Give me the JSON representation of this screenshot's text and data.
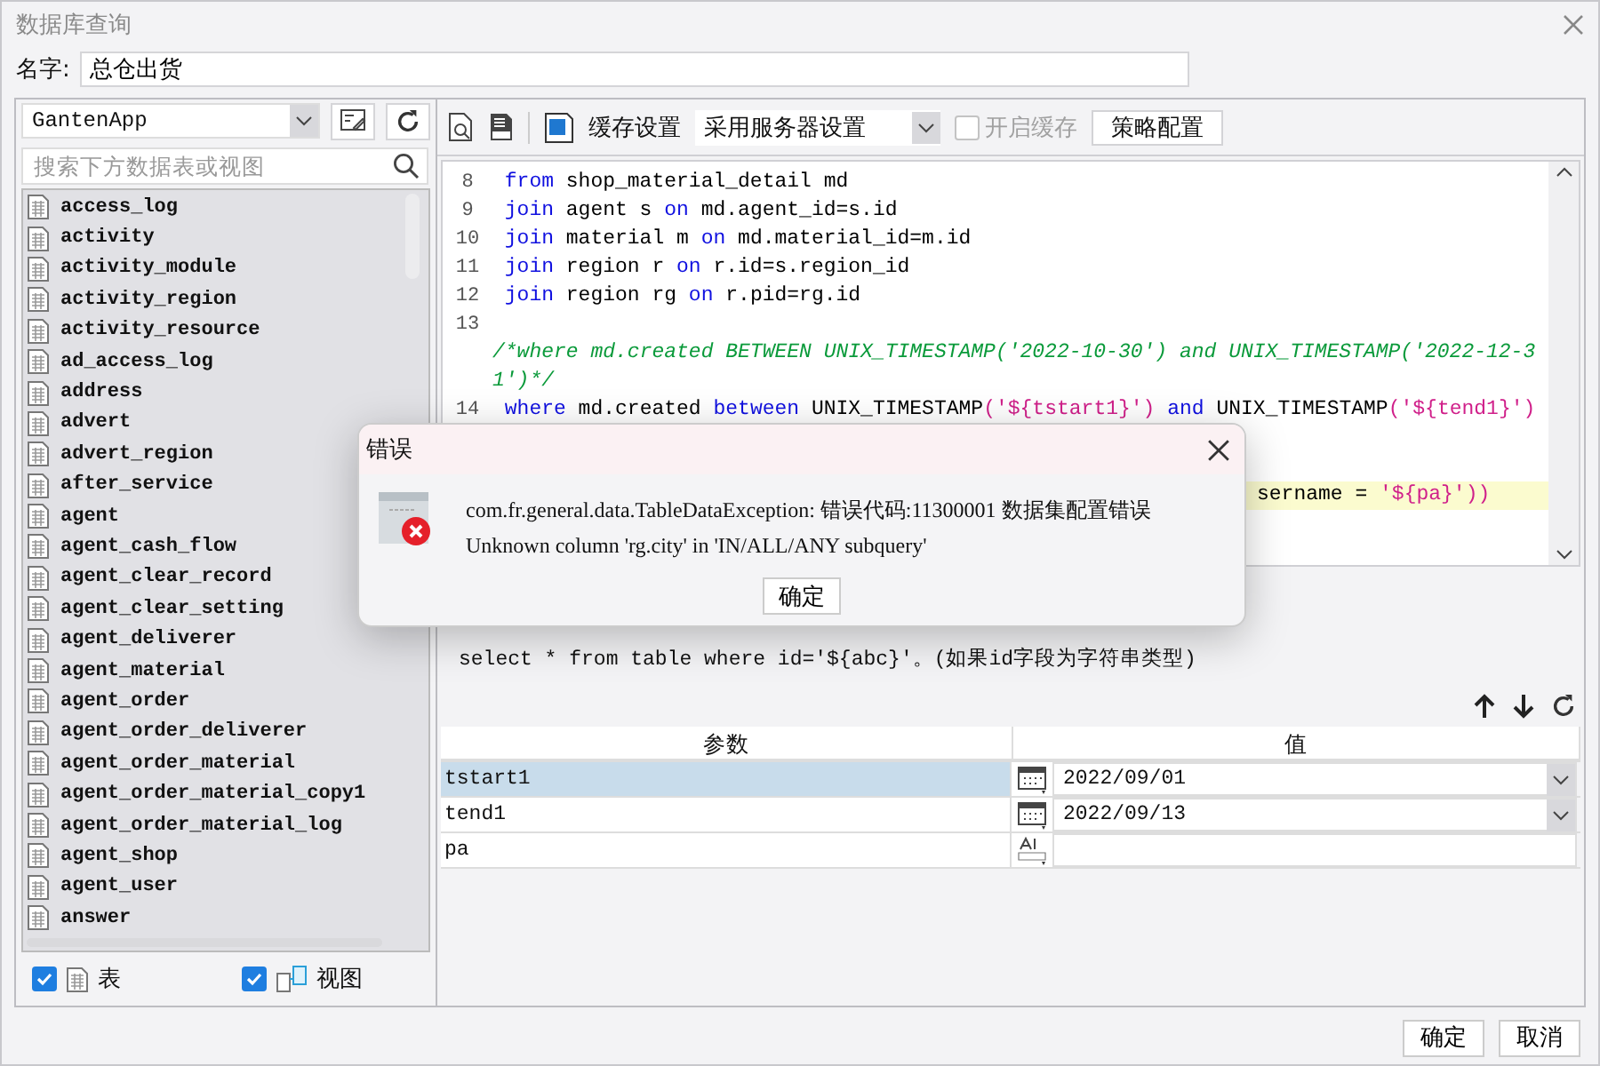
{
  "window": {
    "title": "数据库查询"
  },
  "name_field": {
    "label": "名字:",
    "value": "总仓出货"
  },
  "sidebar": {
    "connection": "GantenApp",
    "search": {
      "placeholder": "搜索下方数据表或视图"
    },
    "items": [
      "access_log",
      "activity",
      "activity_module",
      "activity_region",
      "activity_resource",
      "ad_access_log",
      "address",
      "advert",
      "advert_region",
      "after_service",
      "agent",
      "agent_cash_flow",
      "agent_clear_record",
      "agent_clear_setting",
      "agent_deliverer",
      "agent_material",
      "agent_order",
      "agent_order_deliverer",
      "agent_order_material",
      "agent_order_material_copy1",
      "agent_order_material_log",
      "agent_shop",
      "agent_user",
      "answer"
    ],
    "filters": [
      {
        "kind": "table",
        "label": "表",
        "checked": true
      },
      {
        "kind": "view",
        "label": "视图",
        "checked": true
      }
    ]
  },
  "toolbar": {
    "cache_label": "缓存设置",
    "cache_mode": "采用服务器设置",
    "enable_cache": {
      "label": "开启缓存",
      "checked": false,
      "disabled": true
    },
    "strategy_button": "策略配置"
  },
  "editor": {
    "lines": [
      {
        "kind": "code",
        "number": "8",
        "tokens": [
          {
            "kind": "keyword",
            "text": "from"
          },
          {
            "kind": "plain",
            "text": " shop_material_detail md"
          }
        ]
      },
      {
        "kind": "code",
        "number": "9",
        "tokens": [
          {
            "kind": "keyword",
            "text": "join"
          },
          {
            "kind": "plain",
            "text": " agent s "
          },
          {
            "kind": "keyword",
            "text": "on"
          },
          {
            "kind": "plain",
            "text": " md.agent_id=s.id"
          }
        ]
      },
      {
        "kind": "code",
        "number": "10",
        "tokens": [
          {
            "kind": "keyword",
            "text": "join"
          },
          {
            "kind": "plain",
            "text": " material m "
          },
          {
            "kind": "keyword",
            "text": "on"
          },
          {
            "kind": "plain",
            "text": " md.material_id=m.id"
          }
        ]
      },
      {
        "kind": "code",
        "number": "11",
        "tokens": [
          {
            "kind": "keyword",
            "text": "join"
          },
          {
            "kind": "plain",
            "text": " region r "
          },
          {
            "kind": "keyword",
            "text": "on"
          },
          {
            "kind": "plain",
            "text": " r.id=s.region_id"
          }
        ]
      },
      {
        "kind": "code",
        "number": "12",
        "tokens": [
          {
            "kind": "keyword",
            "text": "join"
          },
          {
            "kind": "plain",
            "text": " region rg "
          },
          {
            "kind": "keyword",
            "text": "on"
          },
          {
            "kind": "plain",
            "text": " r.pid=rg.id"
          }
        ]
      },
      {
        "kind": "code",
        "number": "13"
      },
      {
        "kind": "comment",
        "text": "/*where md.created BETWEEN UNIX_TIMESTAMP('2022-10-30') and UNIX_TIMESTAMP('2022-12-31')*/"
      },
      {
        "kind": "code",
        "number": "14",
        "tokens": [
          {
            "kind": "keyword",
            "text": "where"
          },
          {
            "kind": "plain",
            "text": " md.created "
          },
          {
            "kind": "keyword",
            "text": "between"
          },
          {
            "kind": "plain",
            "text": " UNIX_TIMESTAMP"
          },
          {
            "kind": "string",
            "text": "('${tstart1}')"
          },
          {
            "kind": "keyword",
            "text": " and"
          },
          {
            "kind": "plain",
            "text": " UNIX_TIMESTAMP"
          },
          {
            "kind": "string",
            "text": "('${tend1}')"
          }
        ]
      },
      {
        "kind": "blank"
      },
      {
        "kind": "blank"
      },
      {
        "kind": "partial",
        "highlighted": true,
        "tokens": [
          {
            "kind": "plain",
            "text": "sername = "
          },
          {
            "kind": "string",
            "text": "'${pa}'))"
          }
        ]
      }
    ]
  },
  "hint": "select * from table where id='${abc}'。(如果id字段为字符串类型)",
  "params": {
    "columns": [
      "参数",
      "值"
    ],
    "rows": [
      {
        "name": "tstart1",
        "kind": "date",
        "value": "2022/09/01",
        "selected": true
      },
      {
        "name": "tend1",
        "kind": "date",
        "value": "2022/09/13",
        "selected": false
      },
      {
        "name": "pa",
        "kind": "text",
        "selected": false
      }
    ]
  },
  "dialog": {
    "title": "错误",
    "lines": [
      "com.fr.general.data.TableDataException: 错误代码:11300001 数据集配置错误",
      "Unknown column 'rg.city' in 'IN/ALL/ANY subquery'"
    ],
    "button": "确定"
  },
  "buttons": [
    "确定",
    "取消"
  ]
}
